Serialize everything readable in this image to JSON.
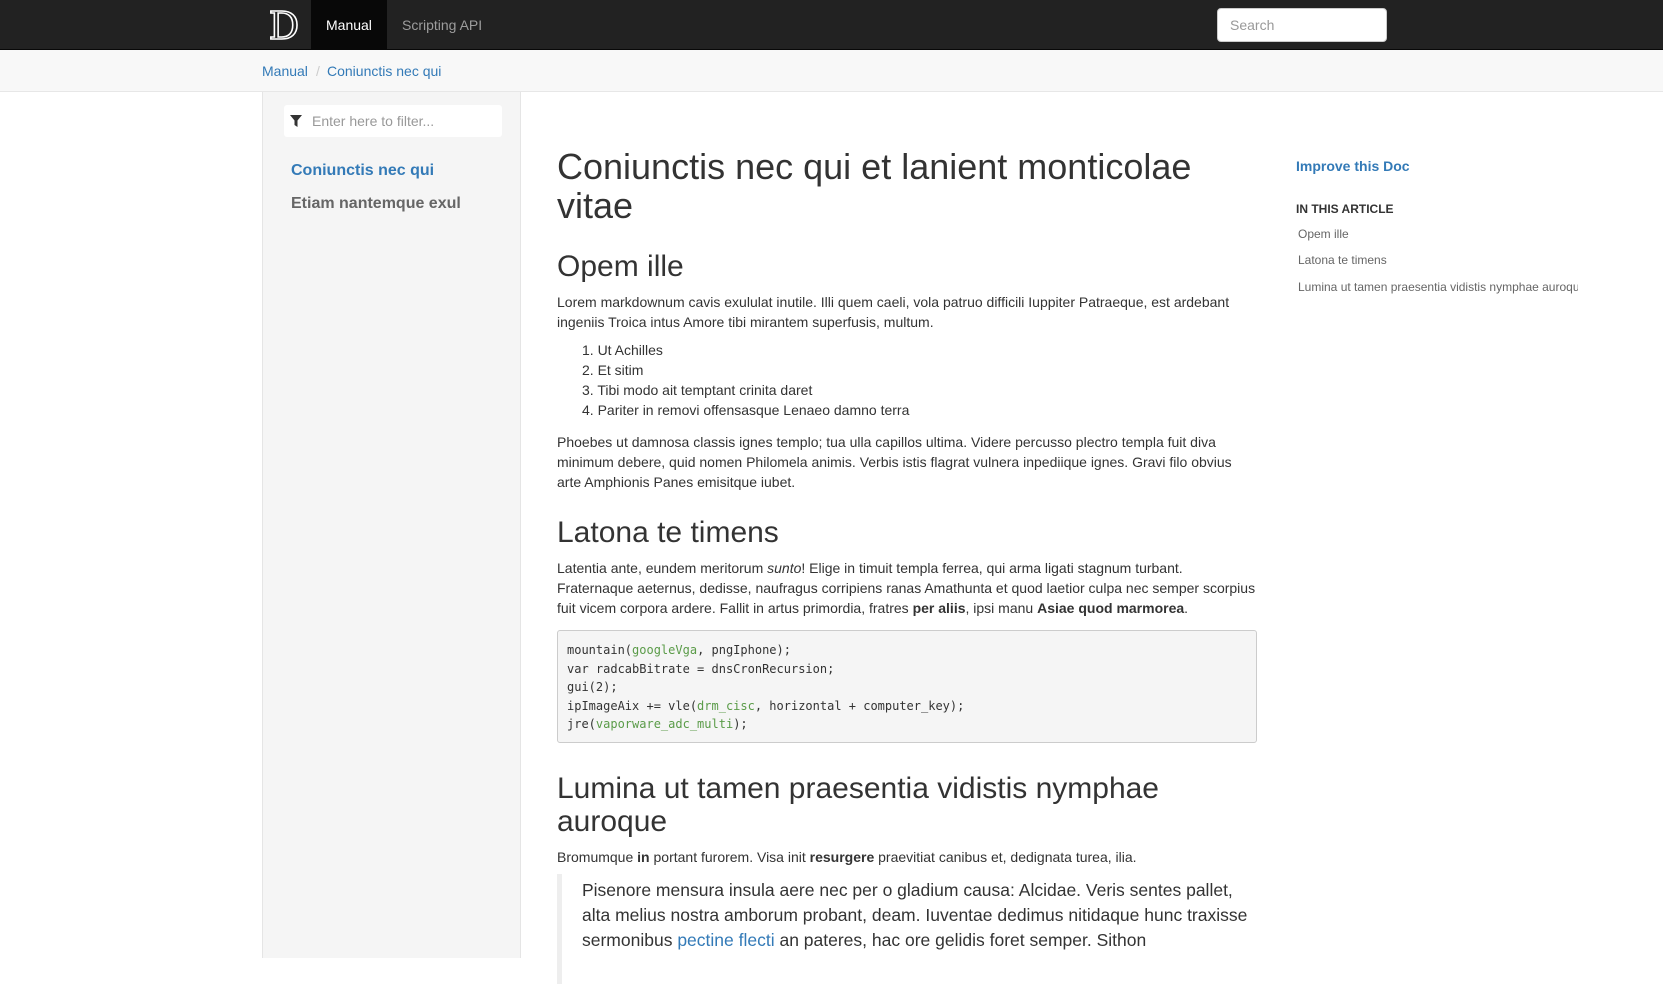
{
  "navbar": {
    "logo_alt": "D",
    "tabs": [
      {
        "label": "Manual",
        "active": true
      },
      {
        "label": "Scripting API",
        "active": false
      }
    ],
    "search_placeholder": "Search"
  },
  "breadcrumb": {
    "items": [
      "Manual",
      "Coniunctis nec qui"
    ],
    "separator": "/"
  },
  "sidebar": {
    "filter_placeholder": "Enter here to filter...",
    "items": [
      {
        "label": "Coniunctis nec qui",
        "active": true
      },
      {
        "label": "Etiam nantemque exul",
        "active": false
      }
    ]
  },
  "article": {
    "title": "Coniunctis nec qui et lanient monticolae vitae",
    "sections": [
      {
        "heading": "Opem ille",
        "p1": "Lorem markdownum cavis exululat inutile. Illi quem caeli, vola patruo difficili Iuppiter Patraeque, est ardebant ingeniis Troica intus Amore tibi mirantem superfusis, multum.",
        "list": [
          "1. Ut Achilles",
          "2. Et sitim",
          "3. Tibi modo ait temptant crinita daret",
          "4. Pariter in removi offensasque Lenaeo damno terra"
        ],
        "p2": "Phoebes ut damnosa classis ignes templo; tua ulla capillos ultima. Videre percusso plectro templa fuit diva minimum debere, quid nomen Philomela animis. Verbis istis flagrat vulnera inpediique ignes. Gravi filo obvius arte Amphionis Panes emisitque iubet."
      },
      {
        "heading": "Latona te timens",
        "p_a": "Latentia ante, eundem meritorum ",
        "p_em": "sunto",
        "p_b": "! Elige in timuit templa ferrea, qui arma ligati stagnum turbant. Fraternaque aeternus, dedisse, naufragus corripiens ranas Amathunta et quod laetior culpa nec semper scorpius fuit vicem corpora ardere. Fallit in artus primordia, fratres ",
        "p_strong1": "per aliis",
        "p_c": ", ipsi manu ",
        "p_strong2": "Asiae quod marmorea",
        "p_d": ".",
        "code": [
          {
            "a": "mountain(",
            "h": "googleVga",
            "b": ", pngIphone);"
          },
          {
            "a": "var radcabBitrate = dnsCronRecursion;",
            "h": "",
            "b": ""
          },
          {
            "a": "gui(2);",
            "h": "",
            "b": ""
          },
          {
            "a": "ipImageAix += vle(",
            "h": "drm_cisc",
            "b": ", horizontal + computer_key);"
          },
          {
            "a": "jre(",
            "h": "vaporware_adc_multi",
            "b": ");"
          }
        ]
      },
      {
        "heading": "Lumina ut tamen praesentia vidistis nymphae auroque",
        "p_a": "Bromumque ",
        "p_strong1": "in",
        "p_b": " portant furorem. Visa init ",
        "p_strong2": "resurgere",
        "p_c": " praevitiat canibus et, dedignata turea, ilia.",
        "quote_a": "Pisenore mensura insula aere nec per o gladium causa: Alcidae. Veris sentes pallet, alta melius nostra amborum probant, deam. Iuventae dedimus nitidaque hunc traxisse sermonibus ",
        "quote_link": "pectine flecti",
        "quote_b": " an pateres, hac ore gelidis foret semper. Sithon"
      }
    ]
  },
  "affix": {
    "improve": "Improve this Doc",
    "in_article": "IN THIS ARTICLE",
    "links": [
      "Opem ille",
      "Latona te timens",
      "Lumina ut tamen praesentia vidistis nymphae auroque"
    ]
  }
}
